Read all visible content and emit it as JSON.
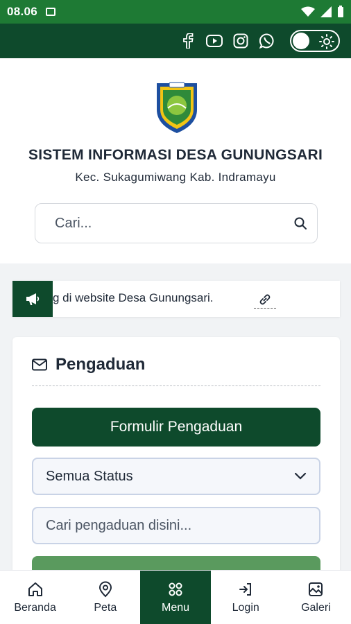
{
  "status_bar": {
    "time": "08.06"
  },
  "topbar": {
    "socials": [
      "facebook-icon",
      "youtube-icon",
      "instagram-icon",
      "whatsapp-icon"
    ]
  },
  "header": {
    "title": "SISTEM INFORMASI DESA GUNUNGSARI",
    "subtitle": "Kec. Sukagumiwang Kab. Indramayu",
    "search_placeholder": "Cari..."
  },
  "ticker": {
    "text": "g di website Desa Gunungsari."
  },
  "card": {
    "title": "Pengaduan",
    "form_button": "Formulir Pengaduan",
    "status_select": "Semua Status",
    "search_placeholder": "Cari pengaduan disini..."
  },
  "nav": {
    "items": [
      {
        "label": "Beranda",
        "icon": "home-icon"
      },
      {
        "label": "Peta",
        "icon": "map-pin-icon"
      },
      {
        "label": "Menu",
        "icon": "grid-icon"
      },
      {
        "label": "Login",
        "icon": "login-icon"
      },
      {
        "label": "Galeri",
        "icon": "gallery-icon"
      }
    ],
    "active": "Menu"
  },
  "colors": {
    "primary": "#0e4a2c",
    "status_bar": "#1e7a34",
    "accent_light": "#5a9a5e"
  }
}
